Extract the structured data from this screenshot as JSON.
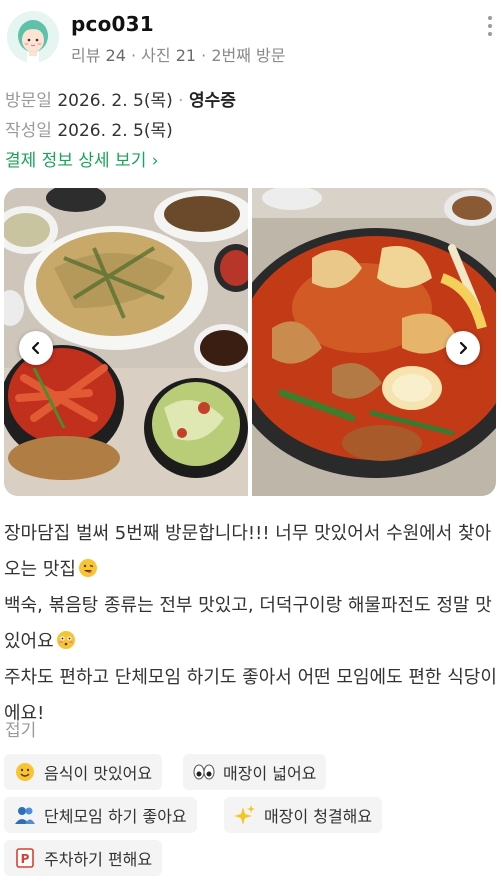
{
  "user": {
    "name": "pco031",
    "review_label": "리뷰",
    "review_count": "24",
    "photo_label": "사진",
    "photo_count": "21",
    "visit_order": "2번째 방문"
  },
  "visit": {
    "visit_label": "방문일",
    "visit_date": "2026. 2. 5(목)",
    "receipt_label": "영수증",
    "written_label": "작성일",
    "written_date": "2026. 2. 5(목)",
    "payment_link": "결제 정보 상세 보기 ›"
  },
  "review": {
    "line1": "장마담집 벌써 5번째 방문합니다!!! 너무 맛있어서 수원에서 찾아오는 맛집",
    "line2": "백숙, 볶음탕 종류는 전부 맛있고, 더덕구이랑 해물파전도 정말 맛있어요",
    "line3": "주차도 편하고 단체모임 하기도 좋아서 어떤 모임에도 편한 식당이에요!",
    "fold_label": "접기"
  },
  "tags": [
    {
      "label": "음식이 맛있어요",
      "icon": "yum-face-icon"
    },
    {
      "label": "매장이 넓어요",
      "icon": "eyes-icon"
    },
    {
      "label": "단체모임 하기 좋아요",
      "icon": "group-icon"
    },
    {
      "label": "매장이 청결해요",
      "icon": "sparkles-icon"
    },
    {
      "label": "주차하기 편해요",
      "icon": "parking-icon"
    }
  ],
  "colors": {
    "link_green": "#1aa35a",
    "tag_bg": "#f4f4f4",
    "muted": "#9a9a9a"
  }
}
